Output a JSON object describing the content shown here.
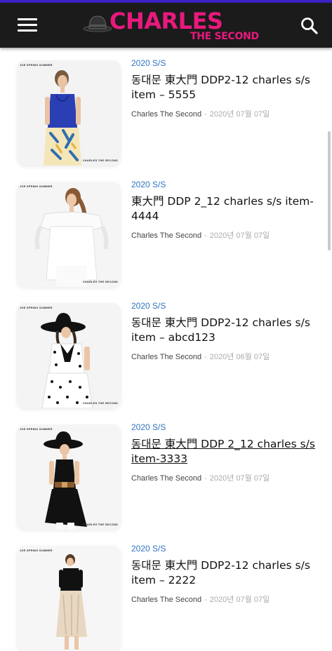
{
  "header": {
    "logo_title": "CHARLES",
    "logo_subtitle": "THE SECOND",
    "menu_icon": "hamburger-menu-icon",
    "search_icon": "search-icon",
    "brand_color": "#e8197d",
    "bar_color": "#1b1b1b"
  },
  "thumb_labels": {
    "top_left": "JOE SPRING SUMMER",
    "bottom_right": "CHARLES THE SECOND"
  },
  "posts": [
    {
      "category": "2020 S/S",
      "title": "동대문 東大門 DDP2-12 charles s/s item – 5555",
      "author": "Charles The Second",
      "date": "2020년 07월 07일",
      "underlined": false
    },
    {
      "category": "2020 S/S",
      "title": "東大門 DDP 2_12 charles s/s item-4444",
      "author": "Charles The Second",
      "date": "2020년 07월 07일",
      "underlined": false
    },
    {
      "category": "2020 S/S",
      "title": "동대문 東大門 DDP2-12 charles s/s item – abcd123",
      "author": "Charles The Second",
      "date": "2020년 06월 07일",
      "underlined": false
    },
    {
      "category": "2020 S/S",
      "title": "동대문 東大門 DDP 2_12 charles s/s item-3333",
      "author": "Charles The Second",
      "date": "2020년 07월 07일",
      "underlined": true
    },
    {
      "category": "2020 S/S",
      "title": "동대문 東大門 DDP2-12 charles s/s item – 2222",
      "author": "Charles The Second",
      "date": "2020년 07월 07일",
      "underlined": false
    }
  ],
  "colors": {
    "category": "#2f74c0",
    "date": "#aaaaaa"
  }
}
